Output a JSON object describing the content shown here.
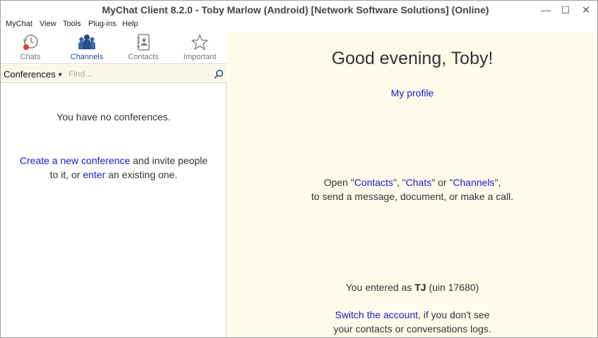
{
  "window": {
    "title": "MyChat Client 8.2.0 - Toby Marlow (Android) [Network Software Solutions] (Online)",
    "minimize": "—",
    "maximize": "☐",
    "close": "✕"
  },
  "menu": [
    "MyChat",
    "View",
    "Tools",
    "Plug-ins",
    "Help"
  ],
  "tabs": [
    {
      "label": "Chats",
      "icon": "chats-history-icon"
    },
    {
      "label": "Channels",
      "icon": "channels-people-icon"
    },
    {
      "label": "Contacts",
      "icon": "contacts-book-icon"
    },
    {
      "label": "Important",
      "icon": "star-icon"
    }
  ],
  "active_tab": "Channels",
  "filter": {
    "selected": "Conferences",
    "placeholder": "Find..."
  },
  "left": {
    "empty": "You have no conferences.",
    "create_link": "Create a new conference",
    "create_mid": " and invite people",
    "create_line2": "to it, or ",
    "enter_link": "enter",
    "create_end": " an existing one."
  },
  "right": {
    "greeting": "Good evening, Toby!",
    "profile_link": "My profile",
    "open_prefix": "Open \"",
    "contacts_link": "Contacts",
    "sep1": "\", \"",
    "chats_link": "Chats",
    "sep2": "\" or \"",
    "channels_link": "Channels",
    "open_suffix": "\",",
    "open_line2": "to send a message, document, or make a call.",
    "entered_prefix": "You entered as ",
    "entered_user": "TJ",
    "entered_suffix": " (uin 17680)",
    "switch_link": "Switch the account",
    "switch_mid": ", if you don't see",
    "switch_line2": "your contacts or conversations logs."
  },
  "colors": {
    "link": "#1a1acc",
    "panel_bg": "#fffbeb",
    "active_tab": "#2a4e86",
    "notify_dot": "#e53935"
  }
}
